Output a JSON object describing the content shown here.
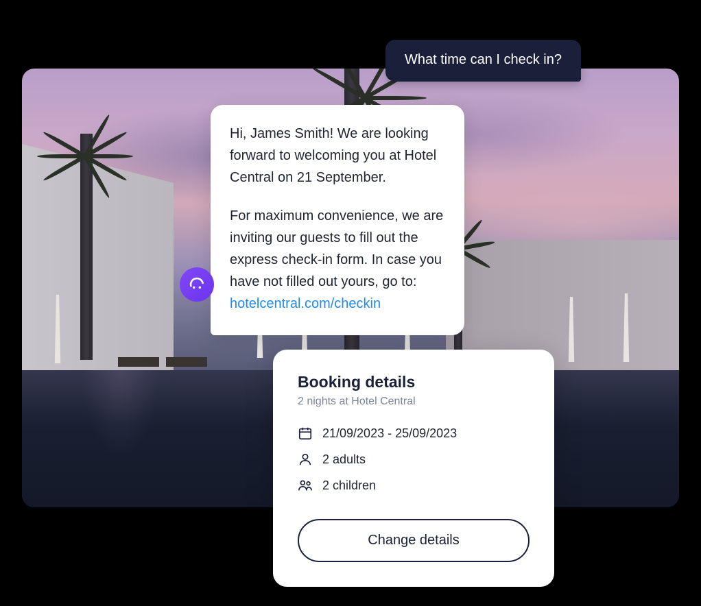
{
  "user_message": "What time can I check in?",
  "bot_message": {
    "paragraph1": "Hi, James Smith! We are looking forward to welcoming you at Hotel Central on 21 September.",
    "paragraph2_prefix": "For maximum convenience, we are inviting our guests to fill out the express check-in form. In case you have not filled out yours, go to: ",
    "link_text": "hotelcentral.com/checkin"
  },
  "booking": {
    "title": "Booking details",
    "subtitle": "2 nights at Hotel Central",
    "dates": "21/09/2023 - 25/09/2023",
    "adults": "2 adults",
    "children": "2 children",
    "change_button": "Change details"
  }
}
